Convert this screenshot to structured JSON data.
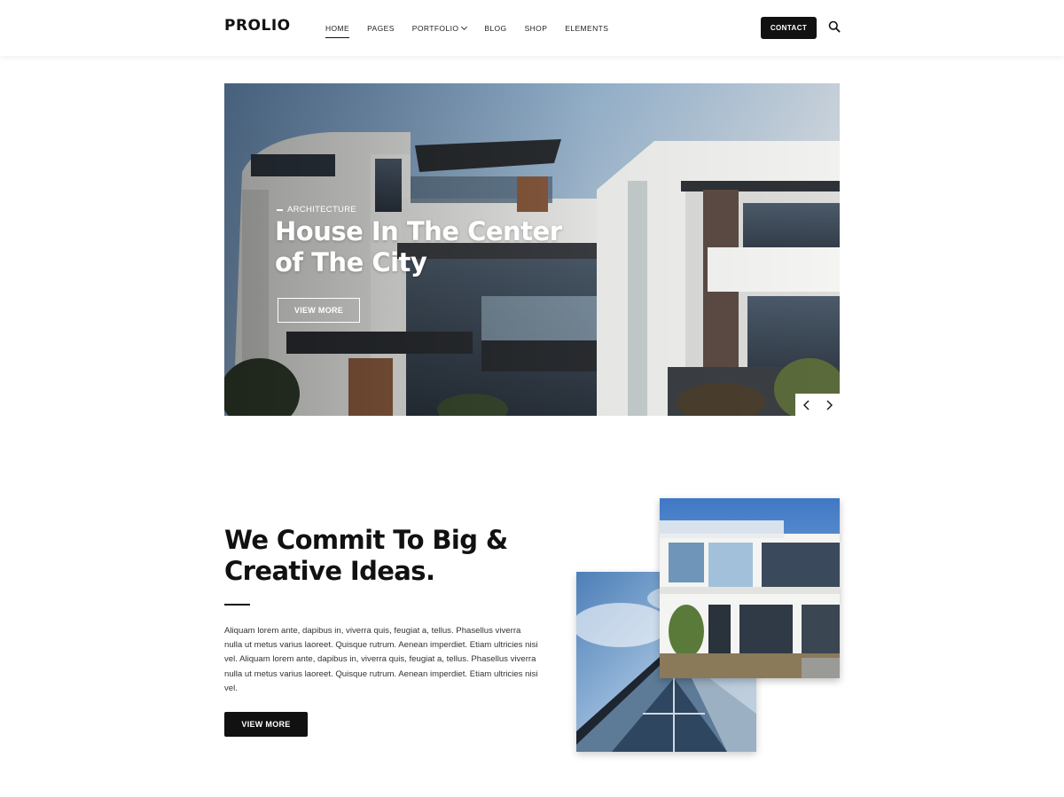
{
  "brand": {
    "logo": "PROLIO"
  },
  "nav": {
    "items": [
      "HOME",
      "PAGES",
      "PORTFOLIO",
      "BLOG",
      "SHOP",
      "ELEMENTS"
    ],
    "active": "HOME",
    "contact_label": "CONTACT"
  },
  "hero": {
    "category": "ARCHITECTURE",
    "title": "House In The Center of The City",
    "button_label": "VIEW MORE"
  },
  "commit": {
    "title": "We Commit To Big & Creative Ideas.",
    "body": "Aliquam lorem ante, dapibus in, viverra quis, feugiat a, tellus. Phasellus viverra nulla ut metus varius laoreet. Quisque rutrum. Aenean imperdiet. Etiam ultricies nisi vel. Aliquam lorem ante, dapibus in, viverra quis, feugiat a, tellus. Phasellus viverra nulla ut metus varius laoreet. Quisque rutrum. Aenean imperdiet. Etiam ultricies nisi vel.",
    "button_label": "VIEW MORE"
  },
  "icons": {
    "search": "search-icon",
    "prev": "chevron-left-icon",
    "next": "chevron-right-icon",
    "dropdown": "chevron-down-icon"
  },
  "colors": {
    "accent": "#111111",
    "background": "#ffffff"
  }
}
